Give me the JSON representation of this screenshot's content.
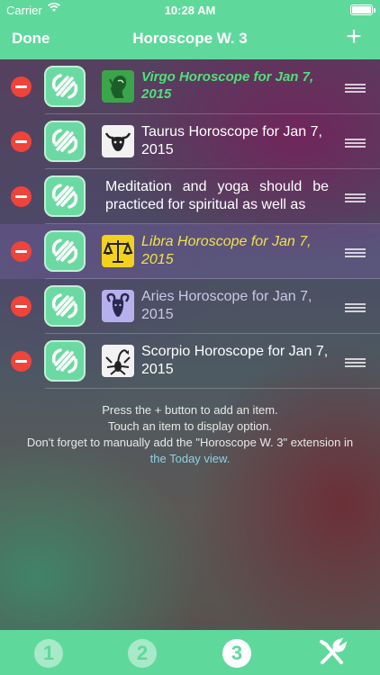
{
  "status_bar": {
    "carrier": "Carrier",
    "time": "10:28 AM"
  },
  "nav": {
    "done_label": "Done",
    "title": "Horoscope W. 3",
    "add_label": "+"
  },
  "colors": {
    "accent": "#5fd89c",
    "delete": "#f0433a",
    "yellow": "#f2e14a",
    "green_text": "#4fe07a"
  },
  "items": [
    {
      "text": "Virgo Horoscope for Jan 7, 2015",
      "sign_icon": "virgo-icon"
    },
    {
      "text": "Taurus Horoscope for Jan 7, 2015",
      "sign_icon": "taurus-icon"
    },
    {
      "text": "Meditation and yoga should be practiced for spiritual as well as"
    },
    {
      "text": "Libra Horoscope for Jan 7, 2015",
      "sign_icon": "libra-icon"
    },
    {
      "text": "Aries Horoscope for Jan 7, 2015",
      "sign_icon": "aries-icon"
    },
    {
      "text": "Scorpio Horoscope for Jan 7, 2015",
      "sign_icon": "scorpio-icon"
    }
  ],
  "footer": {
    "line1": "Press the + button to add an item.",
    "line2": "Touch an item to display option.",
    "line3": "Don't forget to manually add the \"Horoscope W. 3\" extension in",
    "line4": "the Today view."
  },
  "tabs": [
    {
      "label": "1",
      "selected": false
    },
    {
      "label": "2",
      "selected": false
    },
    {
      "label": "3",
      "selected": true
    },
    {
      "icon": "tools-icon"
    }
  ]
}
